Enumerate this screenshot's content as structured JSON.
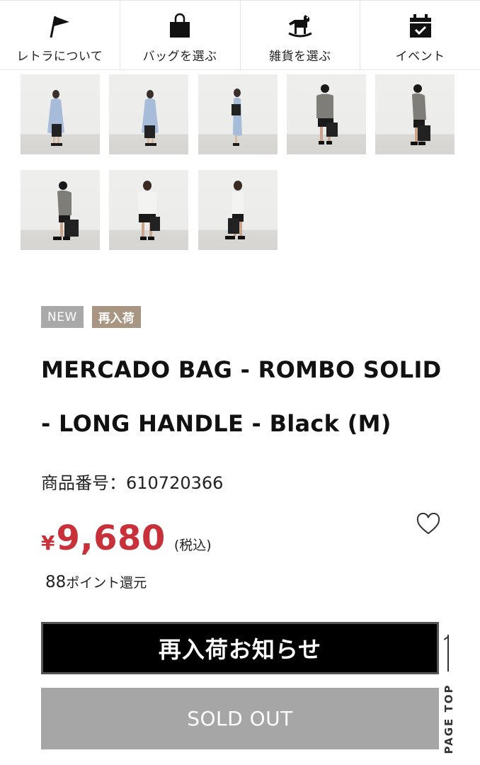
{
  "nav": {
    "items": [
      {
        "label": "レトラについて",
        "icon": "flag-icon"
      },
      {
        "label": "バッグを選ぶ",
        "icon": "bag-icon"
      },
      {
        "label": "雑貨を選ぶ",
        "icon": "rocking-horse-icon"
      },
      {
        "label": "イベント",
        "icon": "calendar-check-icon"
      }
    ]
  },
  "gallery": {
    "thumbnails": [
      {
        "model": "woman-blue-dress",
        "pose": "front"
      },
      {
        "model": "woman-blue-dress",
        "pose": "front-2"
      },
      {
        "model": "woman-blue-dress",
        "pose": "side"
      },
      {
        "model": "man-grey-top-cap",
        "pose": "front"
      },
      {
        "model": "man-grey-top-cap",
        "pose": "side"
      },
      {
        "model": "man-grey-top-cap",
        "pose": "side-2"
      },
      {
        "model": "man-white-tee",
        "pose": "front"
      },
      {
        "model": "man-white-tee",
        "pose": "side"
      }
    ]
  },
  "product": {
    "badges": {
      "new": "NEW",
      "restock": "再入荷"
    },
    "title": "MERCADO BAG - ROMBO SOLID - LONG HANDLE - Black (M)",
    "code_label": "商品番号",
    "code_separator": "：",
    "code_value": "610720366",
    "price_symbol": "¥",
    "price": "9,680",
    "tax_label": "(税込)",
    "points_value": "88",
    "points_label": "ポイント還元",
    "favorite_icon": "heart-outline-icon"
  },
  "actions": {
    "notify_label": "再入荷お知らせ",
    "soldout_label": "SOLD OUT"
  },
  "pagetop": {
    "label": "PAGE TOP"
  },
  "colors": {
    "price": "#c8303a",
    "badge_new": "#a9a9a9",
    "badge_restock": "#a89582",
    "notify_bg": "#000000",
    "soldout_bg": "#a6a6a6"
  }
}
